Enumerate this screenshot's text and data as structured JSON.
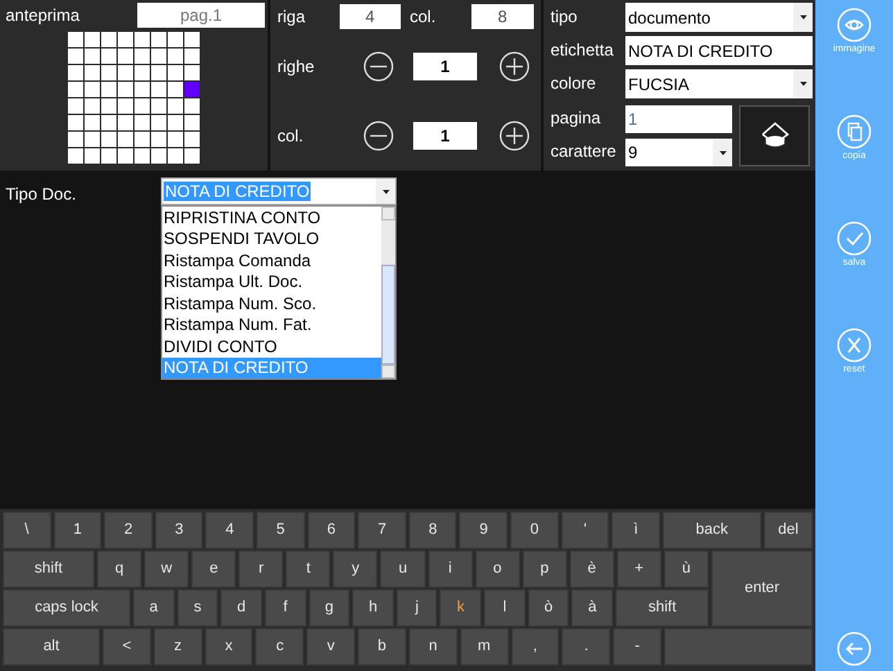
{
  "preview": {
    "label": "anteprima",
    "page": "pag.1",
    "grid": [
      {
        "cells": [
          {
            "selected": false
          },
          {
            "selected": false
          },
          {
            "selected": false
          },
          {
            "selected": false
          },
          {
            "selected": false
          },
          {
            "selected": false
          },
          {
            "selected": false
          },
          {
            "selected": false
          }
        ]
      },
      {
        "cells": [
          {
            "selected": false
          },
          {
            "selected": false
          },
          {
            "selected": false
          },
          {
            "selected": false
          },
          {
            "selected": false
          },
          {
            "selected": false
          },
          {
            "selected": false
          },
          {
            "selected": false
          }
        ]
      },
      {
        "cells": [
          {
            "selected": false
          },
          {
            "selected": false
          },
          {
            "selected": false
          },
          {
            "selected": false
          },
          {
            "selected": false
          },
          {
            "selected": false
          },
          {
            "selected": false
          },
          {
            "selected": false
          }
        ]
      },
      {
        "cells": [
          {
            "selected": false
          },
          {
            "selected": false
          },
          {
            "selected": false
          },
          {
            "selected": false
          },
          {
            "selected": false
          },
          {
            "selected": false
          },
          {
            "selected": false
          },
          {
            "selected": true
          }
        ]
      },
      {
        "cells": [
          {
            "selected": false
          },
          {
            "selected": false
          },
          {
            "selected": false
          },
          {
            "selected": false
          },
          {
            "selected": false
          },
          {
            "selected": false
          },
          {
            "selected": false
          },
          {
            "selected": false
          }
        ]
      },
      {
        "cells": [
          {
            "selected": false
          },
          {
            "selected": false
          },
          {
            "selected": false
          },
          {
            "selected": false
          },
          {
            "selected": false
          },
          {
            "selected": false
          },
          {
            "selected": false
          },
          {
            "selected": false
          }
        ]
      },
      {
        "cells": [
          {
            "selected": false
          },
          {
            "selected": false
          },
          {
            "selected": false
          },
          {
            "selected": false
          },
          {
            "selected": false
          },
          {
            "selected": false
          },
          {
            "selected": false
          },
          {
            "selected": false
          }
        ]
      },
      {
        "cells": [
          {
            "selected": false
          },
          {
            "selected": false
          },
          {
            "selected": false
          },
          {
            "selected": false
          },
          {
            "selected": false
          },
          {
            "selected": false
          },
          {
            "selected": false
          },
          {
            "selected": false
          }
        ]
      }
    ]
  },
  "position": {
    "riga_label": "riga",
    "riga": "4",
    "col_label": "col.",
    "col": "8",
    "spans": [
      {
        "label": "righe",
        "value": "1"
      },
      {
        "label": "col.",
        "value": "1"
      }
    ]
  },
  "properties": {
    "fields": [
      {
        "kind": "select",
        "label": "tipo",
        "value": "documento"
      },
      {
        "kind": "text",
        "label": "etichetta",
        "value": "NOTA DI CREDITO"
      },
      {
        "kind": "select",
        "label": "colore",
        "value": "FUCSIA"
      },
      {
        "kind": "text",
        "label": "pagina",
        "value": "1",
        "disabled": true
      },
      {
        "kind": "select",
        "label": "carattere",
        "value": "9"
      }
    ]
  },
  "doc_type": {
    "label": "Tipo Doc.",
    "value": "NOTA DI CREDITO",
    "expanded": true,
    "options": [
      {
        "label": "RIPRISTINA CONTO",
        "selected": false
      },
      {
        "label": "SOSPENDI TAVOLO",
        "selected": false
      },
      {
        "label": "Ristampa Comanda",
        "selected": false
      },
      {
        "label": "Ristampa Ult. Doc.",
        "selected": false
      },
      {
        "label": "Ristampa Num. Sco.",
        "selected": false
      },
      {
        "label": "Ristampa Num. Fat.",
        "selected": false
      },
      {
        "label": "DIVIDI CONTO",
        "selected": false
      },
      {
        "label": "NOTA DI CREDITO",
        "selected": true
      }
    ]
  },
  "keyboard": {
    "rows": [
      {
        "keys": [
          {
            "label": "\\"
          },
          {
            "label": "1"
          },
          {
            "label": "2"
          },
          {
            "label": "3"
          },
          {
            "label": "4"
          },
          {
            "label": "5"
          },
          {
            "label": "6"
          },
          {
            "label": "7"
          },
          {
            "label": "8"
          },
          {
            "label": "9"
          },
          {
            "label": "0"
          },
          {
            "label": "'"
          },
          {
            "label": "ì"
          },
          {
            "kind": "back",
            "label": "back"
          },
          {
            "kind": "del",
            "label": "del"
          }
        ]
      },
      {
        "keys": [
          {
            "kind": "shift",
            "label": "shift"
          },
          {
            "label": "q"
          },
          {
            "label": "w"
          },
          {
            "label": "e"
          },
          {
            "label": "r"
          },
          {
            "label": "t"
          },
          {
            "label": "y"
          },
          {
            "label": "u"
          },
          {
            "label": "i"
          },
          {
            "label": "o"
          },
          {
            "label": "p"
          },
          {
            "label": "è"
          },
          {
            "label": "+"
          },
          {
            "label": "ù"
          },
          {
            "kind": "enter",
            "label": "enter"
          }
        ]
      },
      {
        "keys": [
          {
            "kind": "caps",
            "label": "caps lock"
          },
          {
            "label": "a"
          },
          {
            "label": "s"
          },
          {
            "label": "d"
          },
          {
            "label": "f"
          },
          {
            "label": "g"
          },
          {
            "label": "h"
          },
          {
            "label": "j"
          },
          {
            "label": "k",
            "highlighted": true
          },
          {
            "label": "l"
          },
          {
            "label": "ò"
          },
          {
            "label": "à"
          },
          {
            "kind": "shift2",
            "label": "shift"
          }
        ]
      },
      {
        "keys": [
          {
            "kind": "alt",
            "label": "alt"
          },
          {
            "label": "<"
          },
          {
            "label": "z"
          },
          {
            "label": "x"
          },
          {
            "label": "c"
          },
          {
            "label": "v"
          },
          {
            "label": "b"
          },
          {
            "label": "n"
          },
          {
            "label": "m"
          },
          {
            "label": ","
          },
          {
            "label": "."
          },
          {
            "label": "-"
          },
          {
            "kind": "blank"
          }
        ]
      }
    ]
  },
  "sidebar": {
    "buttons": [
      {
        "kind": "image",
        "label": "immagine"
      },
      {
        "kind": "copy",
        "label": "copia"
      },
      {
        "kind": "save",
        "label": "salva"
      },
      {
        "kind": "reset",
        "label": "reset"
      },
      {
        "kind": "back"
      }
    ]
  }
}
